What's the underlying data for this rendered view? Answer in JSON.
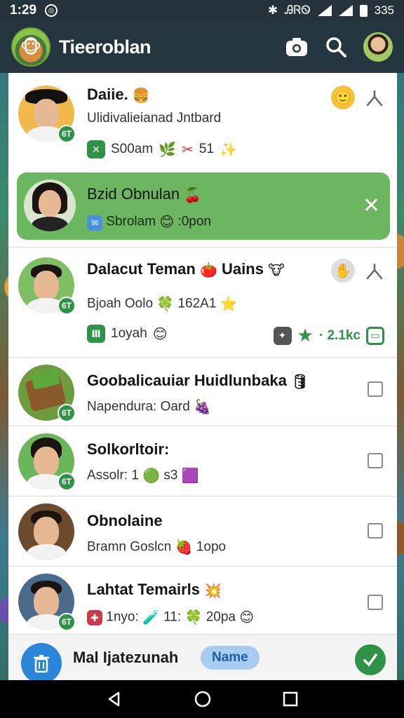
{
  "status": {
    "time": "1:29",
    "right_text": "ᎯᏒᏫ",
    "battery": "335"
  },
  "appbar": {
    "title": "Tieeroblan",
    "logo_icon": "game-character-icon",
    "actions": [
      "camera-icon",
      "search-icon",
      "profile-avatar"
    ]
  },
  "rows": [
    {
      "name": "Daiie.",
      "name_emoji": "🍔",
      "sub": "Ulidivalieianad Jntbard",
      "meta": {
        "a": "S00am",
        "b": "51"
      },
      "badge": "6T",
      "emoji_right": "🙂"
    },
    {
      "name": "Bzid Obnulan",
      "name_emoji": "🍒",
      "sub": "Sbrolam",
      "sub2": ":0pon",
      "close": "✕"
    },
    {
      "name": "Dalacut Teman",
      "name_emoji2": "🍅",
      "name_tail": "Uains",
      "name_emoji3": "🐮",
      "sub": "Bjoah Oolo",
      "sub_tail": "162A1",
      "meta_left": "1oyah",
      "meta_right": "· 2.1kc",
      "badge": "6T"
    },
    {
      "name": "Goobalicauiar Huidlunbaka",
      "sub": "Napendura: Oard",
      "badge": "6T"
    },
    {
      "name": "Solkorltoir:",
      "sub": "Assolr: 1",
      "sub_tail": "s3",
      "badge": "6T"
    },
    {
      "name": "Obnolaine",
      "sub": "Bramn Goslcn",
      "sub_tail": "1opo"
    },
    {
      "name": "Lahtat Temairls",
      "sub": "1nyo:",
      "sub_b": "11:",
      "sub_c": "20pa",
      "badge": "6T"
    }
  ],
  "bottom": {
    "label": "Mal Ijatezunah",
    "pill": "Name"
  },
  "colors": {
    "accent": "#2e9247",
    "highlight": "#6cb561",
    "appbar": "#253540"
  }
}
